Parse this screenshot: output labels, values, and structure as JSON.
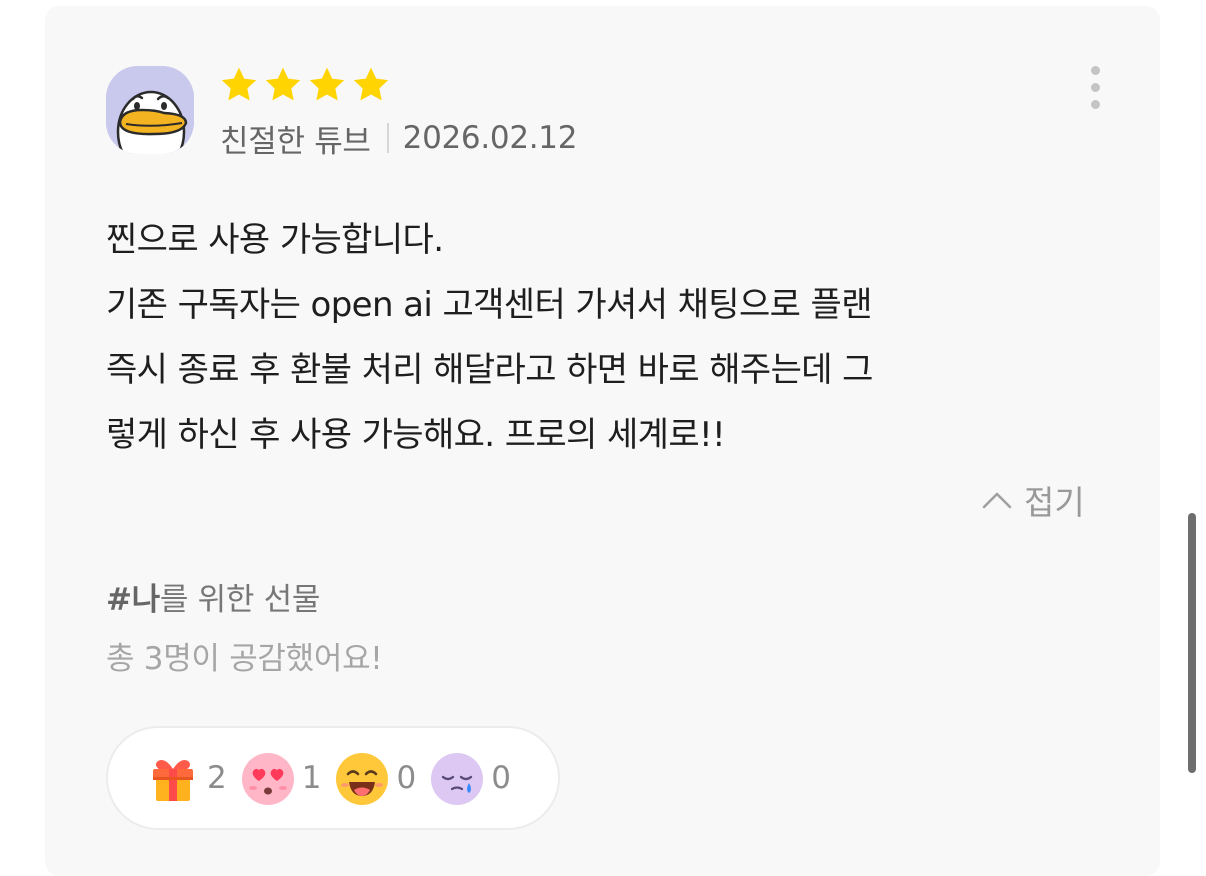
{
  "review": {
    "rating": 4,
    "rating_max": 4,
    "author": "친절한 튜브",
    "date": "2026.02.12",
    "lines": [
      "찐으로 사용 가능합니다.",
      "기존 구독자는 open ai 고객센터 가셔서 채팅으로 플랜",
      "즉시 종료 후 환불 처리 해달라고 하면 바로 해주는데 그",
      "렇게 하신 후 사용 가능해요. 프로의 세계로!!"
    ],
    "collapse_label": "접기",
    "tag_hash": "#나",
    "tag_rest": "를 위한 선물",
    "empathy_text": "총 3명이 공감했어요!"
  },
  "reactions": [
    {
      "icon": "gift-icon",
      "count": "2"
    },
    {
      "icon": "heart-eyes-icon",
      "count": "1"
    },
    {
      "icon": "laughing-face-icon",
      "count": "0"
    },
    {
      "icon": "crying-face-icon",
      "count": "0"
    }
  ],
  "colors": {
    "star": "#ffd400",
    "card_background": "#f8f8f8",
    "avatar_background": "#c9c9ee"
  }
}
